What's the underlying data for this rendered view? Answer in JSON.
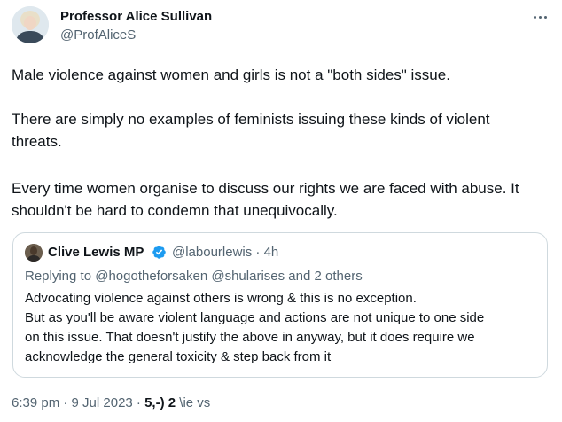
{
  "author": {
    "name": "Professor Alice Sullivan",
    "handle": "@ProfAliceS"
  },
  "tweet": {
    "paragraphs": [
      "Male violence against women and girls is not a \"both sides\" issue.",
      "There are simply no examples of feminists issuing these kinds of violent threats.",
      "Every time women organise to discuss our rights we are faced with abuse. It shouldn't be hard to condemn that unequivocally."
    ]
  },
  "quote": {
    "name": "Clive Lewis MP",
    "handle_time": "@labourlewis · 4h",
    "reply_prefix": "Replying to",
    "reply_mentions": "@hogotheforsaken @shularises",
    "reply_suffix": "and 2 others",
    "lines": [
      "Advocating violence against others  is wrong & this is no exception.",
      "But as you'll be aware violent language and actions are not unique to one side",
      "on this issue. That doesn't justify the above in anyway, but it does require we",
      "acknowledge the general toxicity & step back from it"
    ],
    "verified_badge_color": "#1d9bf0"
  },
  "meta": {
    "timestamp": "6:39 pm · 9 Jul 2023 ·",
    "views_count": "5,-) 2",
    "views_label": "\\ie vs"
  },
  "icons": {
    "more": "more-dots-icon",
    "verified": "verified-badge-icon"
  }
}
